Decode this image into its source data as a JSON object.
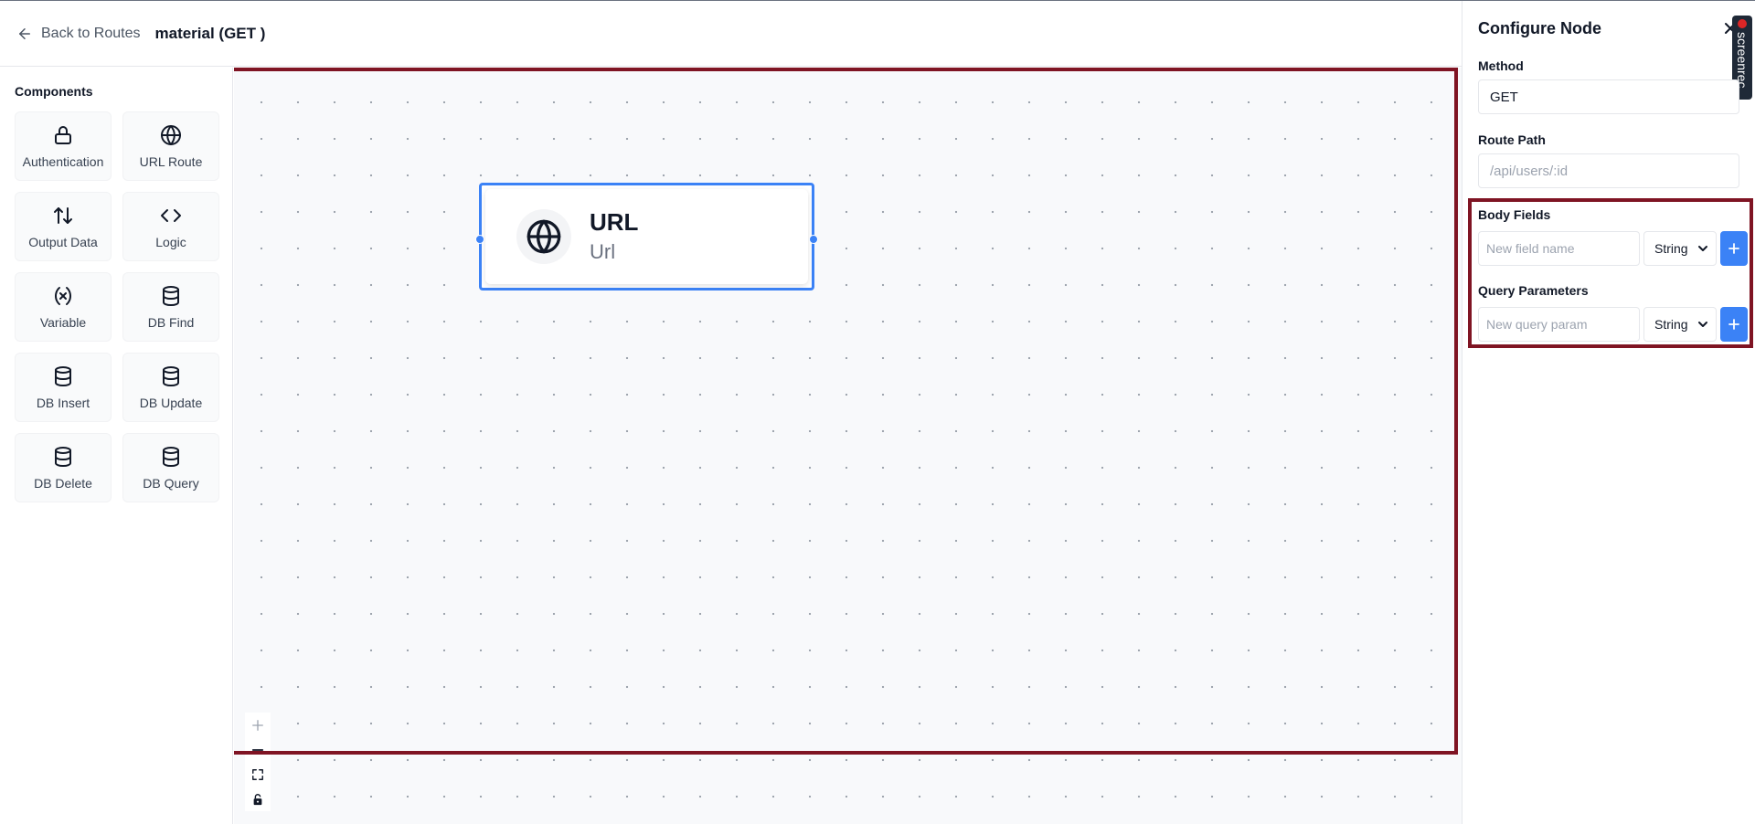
{
  "header": {
    "back_label": "Back to Routes",
    "route_title": "material (GET )"
  },
  "sidebar": {
    "heading": "Components",
    "items": [
      {
        "label": "Authentication",
        "icon": "lock-icon"
      },
      {
        "label": "URL Route",
        "icon": "globe-icon"
      },
      {
        "label": "Output Data",
        "icon": "arrows-up-down-icon"
      },
      {
        "label": "Logic",
        "icon": "code-icon"
      },
      {
        "label": "Variable",
        "icon": "variable-icon"
      },
      {
        "label": "DB Find",
        "icon": "database-icon"
      },
      {
        "label": "DB Insert",
        "icon": "database-icon"
      },
      {
        "label": "DB Update",
        "icon": "database-icon"
      },
      {
        "label": "DB Delete",
        "icon": "database-icon"
      },
      {
        "label": "DB Query",
        "icon": "database-icon"
      }
    ]
  },
  "canvas": {
    "node": {
      "title": "URL",
      "subtitle": "Url",
      "icon": "globe-icon"
    },
    "controls": [
      "zoom-in-icon",
      "zoom-out-icon",
      "fit-view-icon",
      "lock-icon"
    ]
  },
  "panel": {
    "title": "Configure Node",
    "method_label": "Method",
    "method_value": "GET",
    "route_path_label": "Route Path",
    "route_path_placeholder": "/api/users/:id",
    "body_fields_label": "Body Fields",
    "body_field_placeholder": "New field name",
    "body_field_type": "String",
    "query_params_label": "Query Parameters",
    "query_param_placeholder": "New query param",
    "query_param_type": "String",
    "recorder_label": "screenrec"
  },
  "colors": {
    "accent": "#3b82f6",
    "highlight": "#7f1423"
  }
}
